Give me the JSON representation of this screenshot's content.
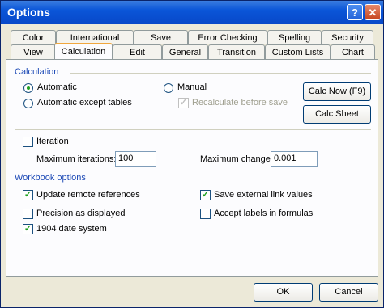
{
  "window": {
    "title": "Options"
  },
  "tabs_row1": [
    "Color",
    "International",
    "Save",
    "Error Checking",
    "Spelling",
    "Security"
  ],
  "tabs_row2": [
    "View",
    "Calculation",
    "Edit",
    "General",
    "Transition",
    "Custom Lists",
    "Chart"
  ],
  "calculation": {
    "heading": "Calculation",
    "automatic": "Automatic",
    "automatic_except_tables": "Automatic except tables",
    "manual": "Manual",
    "recalc_before_save": "Recalculate before save",
    "calc_now": "Calc Now (F9)",
    "calc_sheet": "Calc Sheet"
  },
  "iteration": {
    "label": "Iteration",
    "max_iterations_label": "Maximum iterations:",
    "max_iterations_value": "100",
    "max_change_label": "Maximum change:",
    "max_change_value": "0.001"
  },
  "workbook": {
    "heading": "Workbook options",
    "update_remote": "Update remote references",
    "precision": "Precision as displayed",
    "date1904": "1904 date system",
    "save_external": "Save external link values",
    "accept_labels": "Accept labels in formulas"
  },
  "footer": {
    "ok": "OK",
    "cancel": "Cancel"
  }
}
